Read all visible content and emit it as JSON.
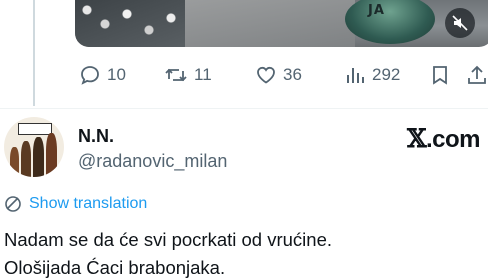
{
  "previous_post": {
    "media": {
      "sign_text": "JA",
      "mute_icon": "speaker-muted-icon"
    },
    "actions": {
      "replies": "10",
      "reposts": "11",
      "likes": "36",
      "views": "292"
    }
  },
  "post": {
    "author_name": "N.N.",
    "author_handle": "@radanovic_milan",
    "brand_label": ".com",
    "brand_mark": "𝕏",
    "translate_label": "Show translation",
    "text_lines": [
      "Nadam se da će svi pocrkati od vrućine.",
      "Ološijada Ćaci brabonjaka."
    ]
  },
  "colors": {
    "text_primary": "#0f1419",
    "text_secondary": "#536471",
    "link_blue": "#1d9bf0",
    "divider": "#eff3f4"
  }
}
